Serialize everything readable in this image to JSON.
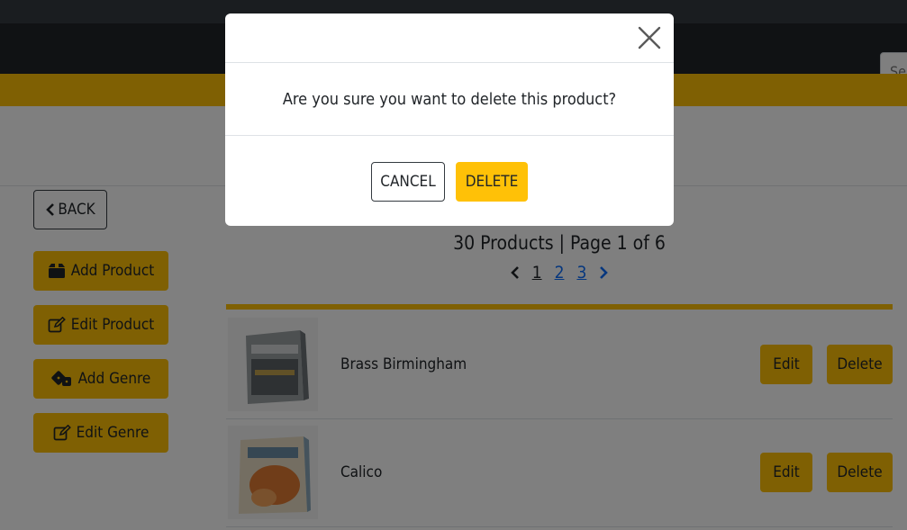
{
  "search": {
    "placeholder": "Search"
  },
  "back_label": "BACK",
  "sidebar": [
    {
      "label": "Add Product"
    },
    {
      "label": "Edit Product"
    },
    {
      "label": "Add Genre"
    },
    {
      "label": "Edit Genre"
    }
  ],
  "listing": {
    "summary": "30 Products | Page 1 of 6",
    "pages": [
      "1",
      "2",
      "3"
    ]
  },
  "products": [
    {
      "name": "Brass Birmingham",
      "edit_label": "Edit",
      "delete_label": "Delete"
    },
    {
      "name": "Calico",
      "edit_label": "Edit",
      "delete_label": "Delete"
    }
  ],
  "modal": {
    "message": "Are you sure you want to delete this product?",
    "cancel_label": "CANCEL",
    "delete_label": "DELETE"
  },
  "colors": {
    "accent": "#ffc107",
    "navbar": "#212529",
    "link": "#0d6efd"
  }
}
